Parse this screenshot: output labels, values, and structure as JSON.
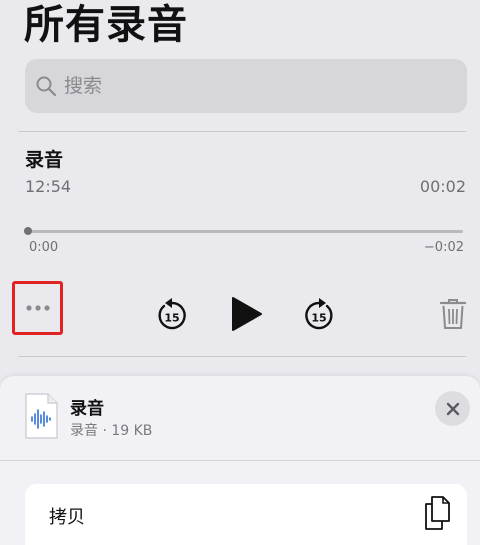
{
  "header": {
    "title": "所有录音"
  },
  "search": {
    "placeholder": "搜索"
  },
  "recording": {
    "name": "录音",
    "time": "12:54",
    "duration": "00:02",
    "elapsed": "0:00",
    "remaining": "−0:02",
    "progress": 0
  },
  "controls": {
    "skip_back_label": "15",
    "skip_forward_label": "15"
  },
  "sheet": {
    "file_name": "录音",
    "file_meta": "录音 · 19 KB",
    "copy_label": "拷贝"
  },
  "colors": {
    "background": "#e9e9ee",
    "highlight": "#e02323",
    "secondary_text": "#6f6f74",
    "file_icon_accent": "#2e6fd6"
  }
}
